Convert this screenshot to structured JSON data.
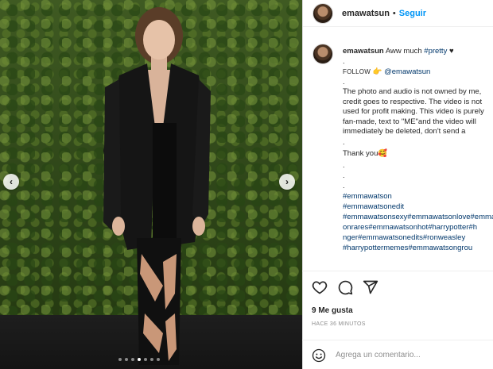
{
  "post": {
    "username": "emawatsun",
    "separator": "•",
    "follow_label": "Seguir"
  },
  "caption": {
    "username": "emawatsun",
    "text_start": "Aww much",
    "hashtag_pretty": "#pretty",
    "heart": "♥",
    "dot1": ".",
    "follow_word": "FOLLOW",
    "follow_emoji": "👉",
    "follow_handle": "@emawatsun",
    "dot2": ".",
    "disclaimer": "The photo and audio is not owned by me, credit goes to respective. The video is not used for profit making. This video is purely fan-made, text to \"ME\"and the video will immediately be deleted, don't send a strike.",
    "dot3": ".",
    "thanks": "Thank you",
    "thanks_emoji": "🥰",
    "dot4": ".",
    "dot5": ".",
    "dot6": ".",
    "hashtags": [
      "#emmawatson",
      "#emmawatsonedit",
      "#emmawatsonsexy#emmawatsonlove#emmawatso",
      "onrares#emmawatsonhot#harrypotter#h",
      "nger#emmawatsonedits#ronweasley",
      "#harrypottermemes#emmawatsongrou"
    ]
  },
  "media": {
    "prev_label": "‹",
    "next_label": "›",
    "dots_count": 7,
    "active_dot": 3
  },
  "engagement": {
    "likes": "9 Me gusta",
    "time": "HACE 36 MINUTOS"
  },
  "comment": {
    "placeholder": "Agrega un comentario..."
  },
  "icons": [
    "heart-icon",
    "comment-icon",
    "share-icon",
    "emoji-icon",
    "chevron-left-icon",
    "chevron-right-icon"
  ]
}
